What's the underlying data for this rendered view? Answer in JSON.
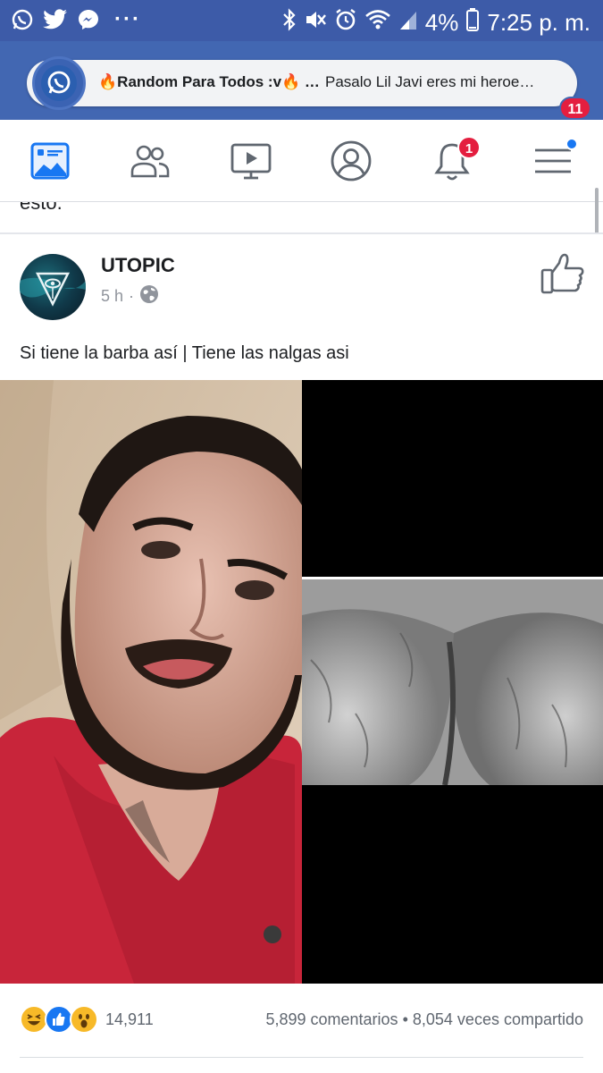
{
  "status_bar": {
    "battery": "4%",
    "time": "7:25 p. m.",
    "dots": "···"
  },
  "chat_head": {
    "name": "🔥Random Para Todos :v🔥 …",
    "message": "Pasalo Lil Javi eres mi heroe…",
    "badge": "11",
    "app_icon": "whatsapp-icon"
  },
  "tabs": [
    {
      "name": "news-feed",
      "icon": "news-feed-icon"
    },
    {
      "name": "friends",
      "icon": "friends-icon"
    },
    {
      "name": "watch",
      "icon": "watch-icon"
    },
    {
      "name": "profile",
      "icon": "profile-icon"
    },
    {
      "name": "notifications",
      "icon": "bell-icon",
      "badge": "1"
    },
    {
      "name": "menu",
      "icon": "menu-icon"
    }
  ],
  "previous_post": {
    "text_fragment": "esto."
  },
  "post": {
    "page_name": "UTOPIC",
    "time": "5 h",
    "separator": "·",
    "privacy_icon": "globe-icon",
    "caption": "Si tiene la barba así  |  Tiene las nalgas asi",
    "reactions": [
      "laugh",
      "like",
      "wow"
    ],
    "reaction_count": "14,911",
    "comments": "5,899 comentarios",
    "stats_separator": "•",
    "shares": "8,054 veces compartido"
  },
  "colors": {
    "facebook_blue": "#4267b2",
    "status_bar": "#3d5ba8",
    "badge_red": "#e41e3f",
    "text_gray": "#606770"
  }
}
